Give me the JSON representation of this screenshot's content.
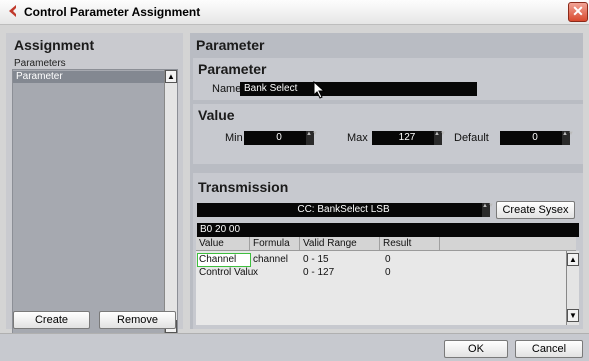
{
  "window": {
    "title": "Control Parameter Assignment",
    "close_symbol": "✕"
  },
  "assignment": {
    "header": "Assignment",
    "list_caption": "Parameters",
    "items": [
      "Parameter"
    ],
    "create_label": "Create",
    "remove_label": "Remove"
  },
  "parameter_panel": {
    "header": "Parameter",
    "parameter_section": {
      "title": "Parameter",
      "name_label": "Name",
      "name_value": "Bank Select"
    },
    "value_section": {
      "title": "Value",
      "min_label": "Min",
      "min_value": "0",
      "max_label": "Max",
      "max_value": "127",
      "default_label": "Default",
      "default_value": "0"
    },
    "transmission": {
      "title": "Transmission",
      "message_value": "CC: BankSelect LSB",
      "create_sysex_label": "Create Sysex",
      "hex_value": "B0 20 00",
      "table": {
        "columns": [
          "Value",
          "Formula",
          "Valid Range",
          "Result"
        ],
        "rows": [
          [
            "Channel",
            "channel",
            "0 - 15",
            "0"
          ],
          [
            "Control Valu",
            "x",
            "0 - 127",
            "0"
          ]
        ]
      }
    }
  },
  "footer": {
    "ok_label": "OK",
    "cancel_label": "Cancel"
  },
  "icons": {
    "scroll_up": "▲",
    "scroll_down": "▼",
    "spin": "▲▼"
  }
}
